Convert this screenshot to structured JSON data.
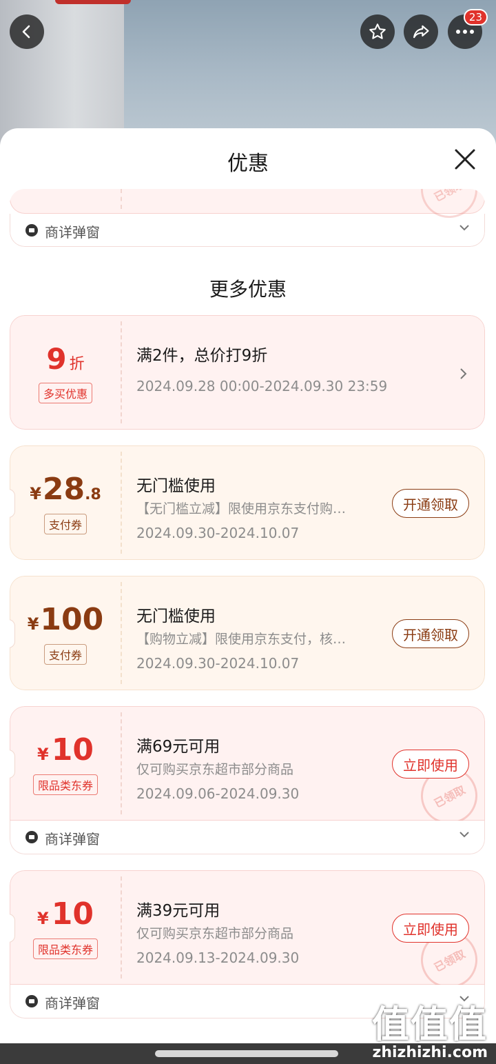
{
  "header": {
    "badge_count": "23"
  },
  "sheet": {
    "title": "优惠",
    "section_title": "更多优惠"
  },
  "top_partial": {
    "detail_label": "商详弹窗",
    "stamp": "已领取"
  },
  "coupons": [
    {
      "amount_main": "9",
      "amount_suffix": "折",
      "tag": "多买优惠",
      "title": "满2件，总价打9折",
      "date": "2024.09.28 00:00-2024.09.30 23:59"
    },
    {
      "currency": "¥",
      "amount_main": "28",
      "amount_suffix": ".8",
      "tag": "支付券",
      "title": "无门槛使用",
      "desc": "【无门槛立减】限使用京东支付购…",
      "date": "2024.09.30-2024.10.07",
      "action": "开通领取"
    },
    {
      "currency": "¥",
      "amount_main": "100",
      "tag": "支付券",
      "title": "无门槛使用",
      "desc": "【购物立减】限使用京东支付，核…",
      "date": "2024.09.30-2024.10.07",
      "action": "开通领取"
    },
    {
      "currency": "¥",
      "amount_main": "10",
      "tag": "限品类东券",
      "title": "满69元可用",
      "desc": "仅可购买京东超市部分商品",
      "date": "2024.09.06-2024.09.30",
      "action": "立即使用",
      "stamp": "已领取",
      "detail_label": "商详弹窗"
    },
    {
      "currency": "¥",
      "amount_main": "10",
      "tag": "限品类东券",
      "title": "满39元可用",
      "desc": "仅可购买京东超市部分商品",
      "date": "2024.09.13-2024.09.30",
      "action": "立即使用",
      "stamp": "已领取",
      "detail_label": "商详弹窗"
    }
  ],
  "watermark": {
    "logo": "值值值",
    "site": "zhizhizhi.com"
  },
  "colors": {
    "red": "#e0322b",
    "brown": "#8a3b12"
  }
}
